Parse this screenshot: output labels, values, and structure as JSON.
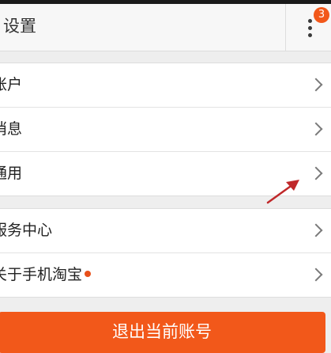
{
  "header": {
    "title": "设置",
    "more_badge": "3"
  },
  "menu_groups": [
    {
      "items": [
        {
          "label": "账户",
          "new_dot": false
        },
        {
          "label": "消息",
          "new_dot": false
        },
        {
          "label": "通用",
          "new_dot": false
        }
      ]
    },
    {
      "items": [
        {
          "label": "服务中心",
          "new_dot": false
        },
        {
          "label": "关于手机淘宝",
          "new_dot": true
        }
      ]
    }
  ],
  "logout": {
    "label": "退出当前账号"
  },
  "colors": {
    "accent": "#f2581a",
    "annotation_arrow": "#c0282a",
    "background": "#eeeeee",
    "row_background": "#ffffff"
  },
  "icons": {
    "more": "more-vertical-icon",
    "row_arrow": "chevron-right-icon"
  }
}
